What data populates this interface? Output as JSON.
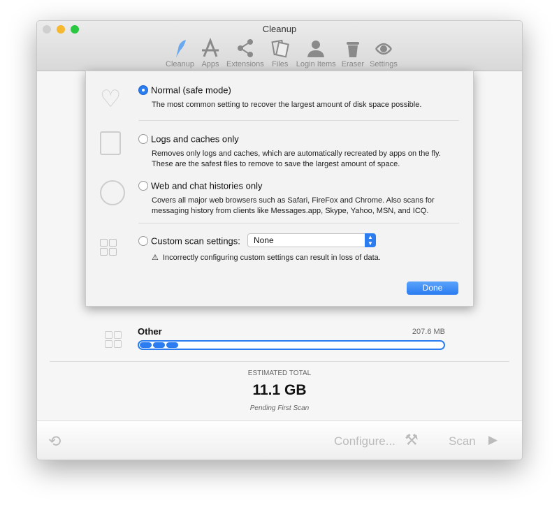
{
  "window": {
    "title": "Cleanup"
  },
  "toolbar": [
    {
      "label": "Cleanup",
      "icon": "feather-icon",
      "active": true
    },
    {
      "label": "Apps",
      "icon": "app-store-icon"
    },
    {
      "label": "Extensions",
      "icon": "share-icon"
    },
    {
      "label": "Files",
      "icon": "files-icon"
    },
    {
      "label": "Login Items",
      "icon": "user-icon"
    },
    {
      "label": "Eraser",
      "icon": "trash-icon"
    },
    {
      "label": "Settings",
      "icon": "settings-icon"
    }
  ],
  "categories": [
    {
      "name": "Other",
      "size": "207.6 MB",
      "fill_percent": 15
    }
  ],
  "total": {
    "label": "ESTIMATED TOTAL",
    "value": "11.1 GB",
    "status": "Pending First Scan"
  },
  "footer": {
    "configure": "Configure...",
    "scan": "Scan"
  },
  "sheet": {
    "options": [
      {
        "label": "Normal (safe mode)",
        "selected": true,
        "desc": [
          "The most common setting to recover the largest amount of disk space possible."
        ]
      },
      {
        "label": "Logs and caches only",
        "selected": false,
        "desc": [
          "Removes only logs and caches, which are automatically recreated by apps on the fly.",
          "These are the safest files to remove to save the largest amount of space."
        ]
      },
      {
        "label": "Web and chat histories only",
        "selected": false,
        "desc": [
          "Covers all major web browsers such as Safari, FireFox and Chrome. Also scans for",
          "messaging history from clients like Messages.app, Skype, Yahoo, MSN, and ICQ."
        ]
      },
      {
        "label": "Custom scan settings:",
        "selected": false
      }
    ],
    "custom_select": "None",
    "warning": "Incorrectly configuring custom settings can result in loss of data.",
    "done": "Done"
  },
  "colors": {
    "accent": "#2a7cf0"
  }
}
